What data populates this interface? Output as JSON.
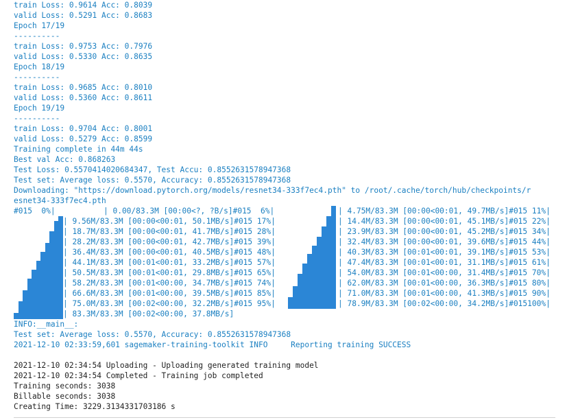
{
  "colors": {
    "log_blue": "#1a7fc1",
    "log_black": "#222222",
    "bar_blue": "#2b86d6",
    "background": "#ffffff"
  },
  "log": {
    "l01": "train Loss: 0.9614 Acc: 0.8039",
    "l02": "valid Loss: 0.5291 Acc: 0.8683",
    "l03": "Epoch 17/19",
    "l04": "----------",
    "l05": "train Loss: 0.9753 Acc: 0.7976",
    "l06": "valid Loss: 0.5330 Acc: 0.8635",
    "l07": "Epoch 18/19",
    "l08": "----------",
    "l09": "train Loss: 0.9685 Acc: 0.8010",
    "l10": "valid Loss: 0.5360 Acc: 0.8611",
    "l11": "Epoch 19/19",
    "l12": "----------",
    "l13": "train Loss: 0.9704 Acc: 0.8001",
    "l14": "valid Loss: 0.5279 Acc: 0.8599",
    "l15": "Training complete in 44m 44s",
    "l16": "Best val Acc: 0.868263",
    "l17": "Test Loss: 0.5570414020684347, Test Accu: 0.8552631578947368",
    "l18": "Test set: Average loss: 0.5570, Accuracy: 0.8552631578947368",
    "l19": "Downloading: \"https://download.pytorch.org/models/resnet34-333f7ec4.pth\" to /root/.cache/torch/hub/checkpoints/r",
    "l20": "esnet34-333f7ec4.pth",
    "l21": "INFO:__main__:",
    "l22": "Test set: Average loss: 0.5570, Accuracy: 0.8552631578947368",
    "l23": "2021-12-10 02:33:59,601 sagemaker-training-toolkit INFO     Reporting training SUCCESS",
    "l24": "2021-12-10 02:34:54 Uploading - Uploading generated training model",
    "l25": "2021-12-10 02:34:54 Completed - Training job completed",
    "l26": "Training seconds: 3038",
    "l27": "Billable seconds: 3038",
    "l28": "Creating Time: 3229.3134331703186 s"
  },
  "progress": {
    "p00": "#015  0%|",
    "p01": "| 0.00/83.3M [00:00<?, ?B/s]#015  6%|",
    "p02": "| 4.75M/83.3M [00:00<00:01, 49.7MB/s]#015 11%|",
    "p03": "| 9.56M/83.3M [00:00<00:01, 50.1MB/s]#015 17%|",
    "p04": "| 14.4M/83.3M [00:00<00:01, 45.1MB/s]#015 22%|",
    "p05": "| 18.7M/83.3M [00:00<00:01, 41.7MB/s]#015 28%|",
    "p06": "| 23.9M/83.3M [00:00<00:01, 45.2MB/s]#015 34%|",
    "p07": "| 28.2M/83.3M [00:00<00:01, 42.7MB/s]#015 39%|",
    "p08": "| 32.4M/83.3M [00:00<00:01, 39.6MB/s]#015 44%|",
    "p09": "| 36.4M/83.3M [00:00<00:01, 40.5MB/s]#015 48%|",
    "p10": "| 40.3M/83.3M [00:01<00:01, 39.1MB/s]#015 53%|",
    "p11": "| 44.1M/83.3M [00:01<00:01, 33.2MB/s]#015 57%|",
    "p12": "| 47.4M/83.3M [00:01<00:01, 31.1MB/s]#015 61%|",
    "p13": "| 50.5M/83.3M [00:01<00:01, 29.8MB/s]#015 65%|",
    "p14": "| 54.0M/83.3M [00:01<00:00, 31.4MB/s]#015 70%|",
    "p15": "| 58.2M/83.3M [00:01<00:00, 34.7MB/s]#015 74%|",
    "p16": "| 62.0M/83.3M [00:01<00:00, 36.3MB/s]#015 80%|",
    "p17": "| 66.6M/83.3M [00:01<00:00, 39.5MB/s]#015 85%|",
    "p18": "| 71.0M/83.3M [00:01<00:00, 41.3MB/s]#015 90%|",
    "p19": "| 75.0M/83.3M [00:02<00:00, 32.2MB/s]#015 95%|",
    "p20": "| 78.9M/83.3M [00:02<00:00, 34.2MB/s]#015100%|",
    "p21": "| 83.3M/83.3M [00:02<00:00, 37.8MB/s]"
  },
  "progress_fractions": {
    "left": [
      0.06,
      0.17,
      0.28,
      0.39,
      0.48,
      0.57,
      0.65,
      0.74,
      0.85,
      0.95,
      1.0
    ],
    "right": [
      0.11,
      0.22,
      0.34,
      0.44,
      0.53,
      0.61,
      0.7,
      0.8,
      0.9,
      1.0
    ]
  }
}
